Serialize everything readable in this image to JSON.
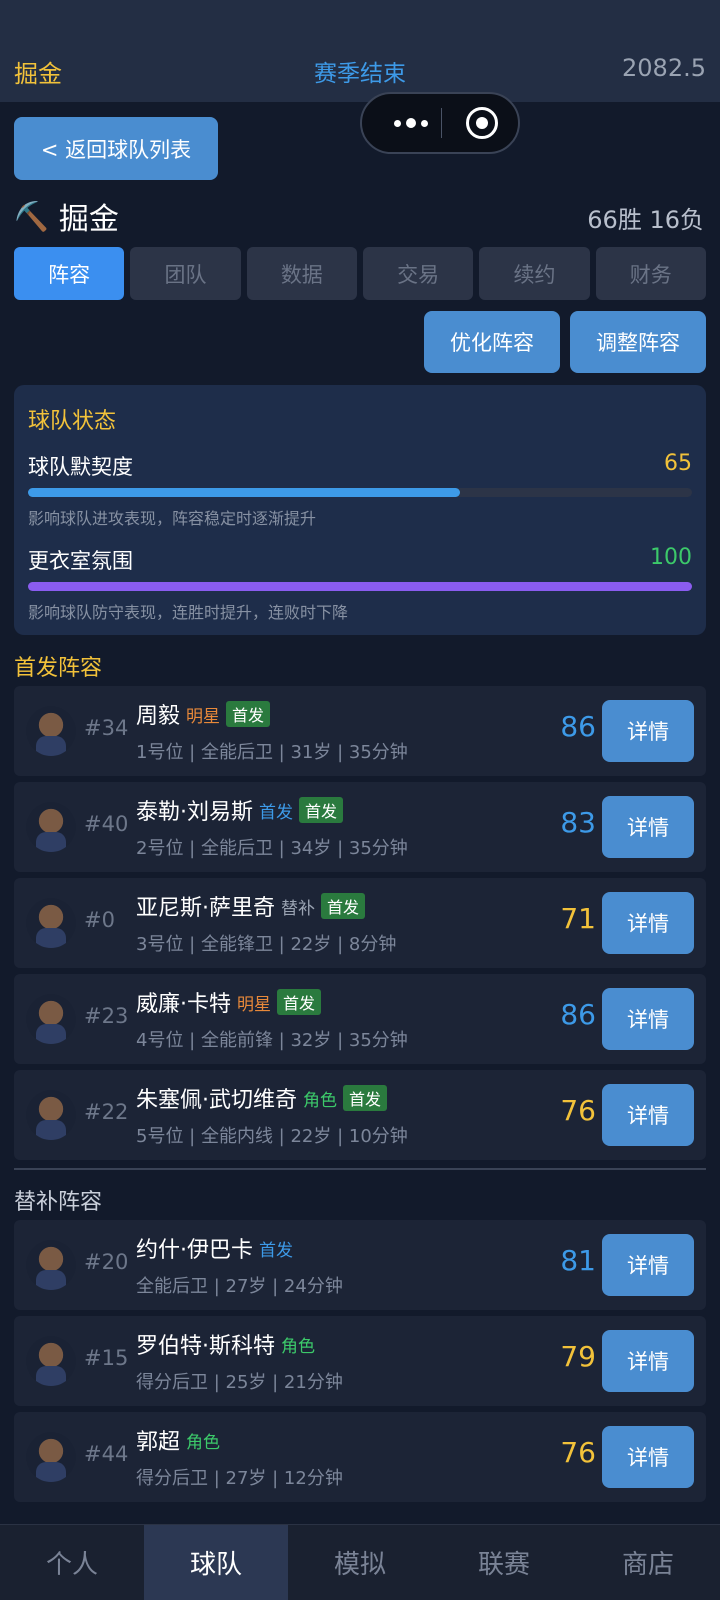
{
  "header": {
    "team_name": "掘金",
    "season_status": "赛季结束",
    "balance": "2082.5"
  },
  "back_button": "< 返回球队列表",
  "team": {
    "icon": "pickaxe-icon",
    "name": "掘金",
    "record": "66胜 16负"
  },
  "tabs": [
    {
      "label": "阵容",
      "active": true
    },
    {
      "label": "团队",
      "active": false
    },
    {
      "label": "数据",
      "active": false
    },
    {
      "label": "交易",
      "active": false
    },
    {
      "label": "续约",
      "active": false
    },
    {
      "label": "财务",
      "active": false
    }
  ],
  "actions": {
    "optimize": "优化阵容",
    "adjust": "调整阵容"
  },
  "team_status": {
    "title": "球队状态",
    "chemistry": {
      "label": "球队默契度",
      "value": "65",
      "level": 0.65,
      "desc": "影响球队进攻表现，阵容稳定时逐渐提升",
      "color": "#3d9ae8"
    },
    "morale": {
      "label": "更衣室氛围",
      "value": "100",
      "level": 1.0,
      "desc": "影响球队防守表现，连胜时提升，连败时下降",
      "color": "#8a5cf0"
    }
  },
  "starters_title": "首发阵容",
  "bench_title": "替补阵容",
  "detail_label": "详情",
  "starters": [
    {
      "number": "#34",
      "name": "周毅",
      "role": "明星",
      "role_color": "#e8893a",
      "badge": "首发",
      "info": "1号位 | 全能后卫 | 31岁 | 35分钟",
      "rating": "86",
      "rating_color": "#3d9ae8"
    },
    {
      "number": "#40",
      "name": "泰勒·刘易斯",
      "role": "首发",
      "role_color": "#3d9ae8",
      "badge": "首发",
      "info": "2号位 | 全能后卫 | 34岁 | 35分钟",
      "rating": "83",
      "rating_color": "#3d9ae8"
    },
    {
      "number": "#0",
      "name": "亚尼斯·萨里奇",
      "role": "替补",
      "role_color": "#9aa3b2",
      "badge": "首发",
      "info": "3号位 | 全能锋卫 | 22岁 | 8分钟",
      "rating": "71",
      "rating_color": "#f2c23a"
    },
    {
      "number": "#23",
      "name": "威廉·卡特",
      "role": "明星",
      "role_color": "#e8893a",
      "badge": "首发",
      "info": "4号位 | 全能前锋 | 32岁 | 35分钟",
      "rating": "86",
      "rating_color": "#3d9ae8"
    },
    {
      "number": "#22",
      "name": "朱塞佩·武切维奇",
      "role": "角色",
      "role_color": "#3cc96a",
      "badge": "首发",
      "info": "5号位 | 全能内线 | 22岁 | 10分钟",
      "rating": "76",
      "rating_color": "#f2c23a"
    }
  ],
  "bench": [
    {
      "number": "#20",
      "name": "约什·伊巴卡",
      "role": "首发",
      "role_color": "#3d9ae8",
      "info": "全能后卫 | 27岁 | 24分钟",
      "rating": "81",
      "rating_color": "#3d9ae8"
    },
    {
      "number": "#15",
      "name": "罗伯特·斯科特",
      "role": "角色",
      "role_color": "#3cc96a",
      "info": "得分后卫 | 25岁 | 21分钟",
      "rating": "79",
      "rating_color": "#f2c23a"
    },
    {
      "number": "#44",
      "name": "郭超",
      "role": "角色",
      "role_color": "#3cc96a",
      "info": "得分后卫 | 27岁 | 12分钟",
      "rating": "76",
      "rating_color": "#f2c23a"
    }
  ],
  "bottom_nav": [
    {
      "label": "个人",
      "active": false
    },
    {
      "label": "球队",
      "active": true
    },
    {
      "label": "模拟",
      "active": false
    },
    {
      "label": "联赛",
      "active": false
    },
    {
      "label": "商店",
      "active": false
    }
  ]
}
